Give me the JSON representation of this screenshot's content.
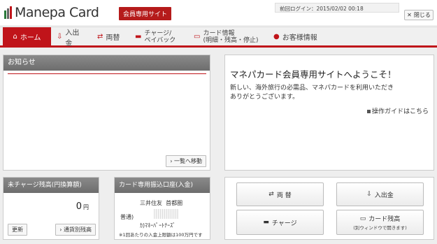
{
  "header": {
    "logo_text": "Manepa Card",
    "member_badge": "会員専用サイト",
    "last_login_label": "前回ログイン：",
    "last_login_value": "2015/02/02 00:18",
    "close_label": "閉じる"
  },
  "nav": {
    "items": [
      {
        "label": "ホーム",
        "icon": "home-icon"
      },
      {
        "label": "入出金",
        "icon": "deposit-icon"
      },
      {
        "label": "両替",
        "icon": "exchange-icon"
      },
      {
        "label_line1": "チャージ/",
        "label_line2": "ペイバック",
        "icon": "card-icon"
      },
      {
        "label_line1": "カード情報",
        "label_line2": "(明細・残高・停止)",
        "icon": "card-info-icon"
      },
      {
        "label": "お客様情報",
        "icon": "person-icon"
      }
    ]
  },
  "notice": {
    "title": "お知らせ",
    "more_label": "一覧へ移動"
  },
  "welcome": {
    "title": "マネパカード会員専用サイトへようこそ！",
    "text_line1": "新しい、海外旅行の必需品、マネパカードを利用いただき",
    "text_line2": "ありがとうございます。",
    "guide_label": "操作ガイドはこちら"
  },
  "charge_balance": {
    "title": "未チャージ残高(円換算額)",
    "amount": "0",
    "unit": "円",
    "refresh_label": "更新",
    "per_currency_label": "通貨別残高"
  },
  "account": {
    "title": "カード専用振込口座(入金)",
    "bank": "三井住友",
    "branch": "首都圏",
    "type": "普通)",
    "name": "ｶ)ﾏﾈｰﾊﾟｰﾄﾅｰｽﾞ",
    "note": "※1回あたりの入金上限額は100万円です"
  },
  "actions": {
    "exchange_label": "両 替",
    "deposit_label": "入出金",
    "charge_label": "チャージ",
    "card_balance_label": "カード残高",
    "card_balance_sub": "(別ウィンドウで開きます)"
  },
  "colors": {
    "brand_red": "#c0141a",
    "panel_header": "#7a7a7a"
  }
}
